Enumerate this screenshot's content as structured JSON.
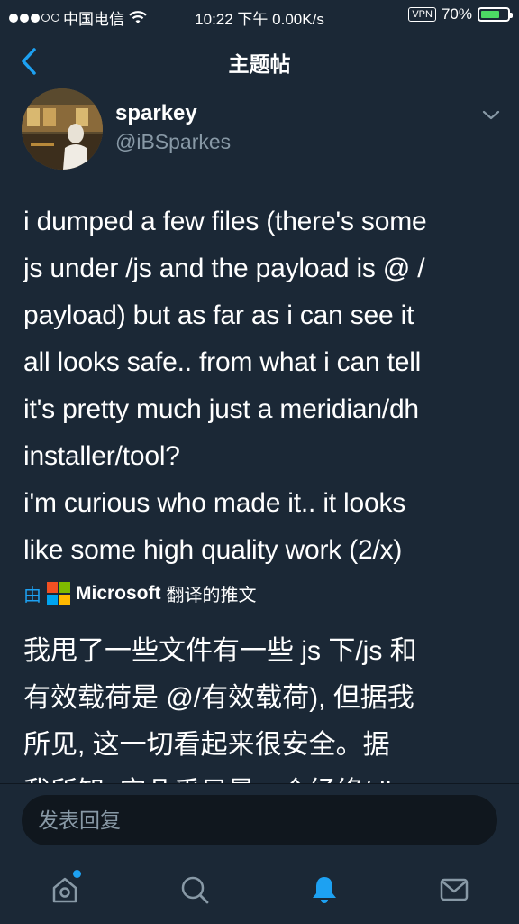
{
  "status_bar": {
    "carrier": "中国电信",
    "time": "10:22 下午",
    "speed": "0.00K/s",
    "vpn": "VPN",
    "battery": "70%",
    "battery_level": 0.7,
    "battery_color": "#4cd964"
  },
  "nav": {
    "title": "主题帖",
    "back_icon": "chevron-left-icon"
  },
  "tweet": {
    "display_name": "sparkey",
    "handle": "@iBSparkes",
    "text": "i dumped a few files (there's some\njs under /js and the payload is @ /\npayload) but as far as i can see it\nall looks safe.. from what i can tell\nit's pretty much just a meridian/dh\ninstaller/tool?\ni'm curious who made it.. it looks\nlike some high quality work (2/x)",
    "translation": {
      "prefix": "由",
      "provider": "Microsoft",
      "suffix": "翻译的推文",
      "text": "我甩了一些文件有一些 js 下/js 和\n有效载荷是 @/有效载荷), 但据我\n所见, 这一切看起来很安全。据\n我所知, 它几乎只是一个经络/dh"
    }
  },
  "reply": {
    "placeholder": "发表回复"
  },
  "tab_bar": {
    "items": [
      {
        "name": "home",
        "icon": "home-icon"
      },
      {
        "name": "search",
        "icon": "search-icon"
      },
      {
        "name": "notifications",
        "icon": "bell-icon",
        "active": true
      },
      {
        "name": "messages",
        "icon": "mail-icon"
      }
    ]
  },
  "colors": {
    "background": "#1b2836",
    "accent": "#1da1f2",
    "secondary_text": "#8899a6",
    "input_bg": "#10171e"
  }
}
